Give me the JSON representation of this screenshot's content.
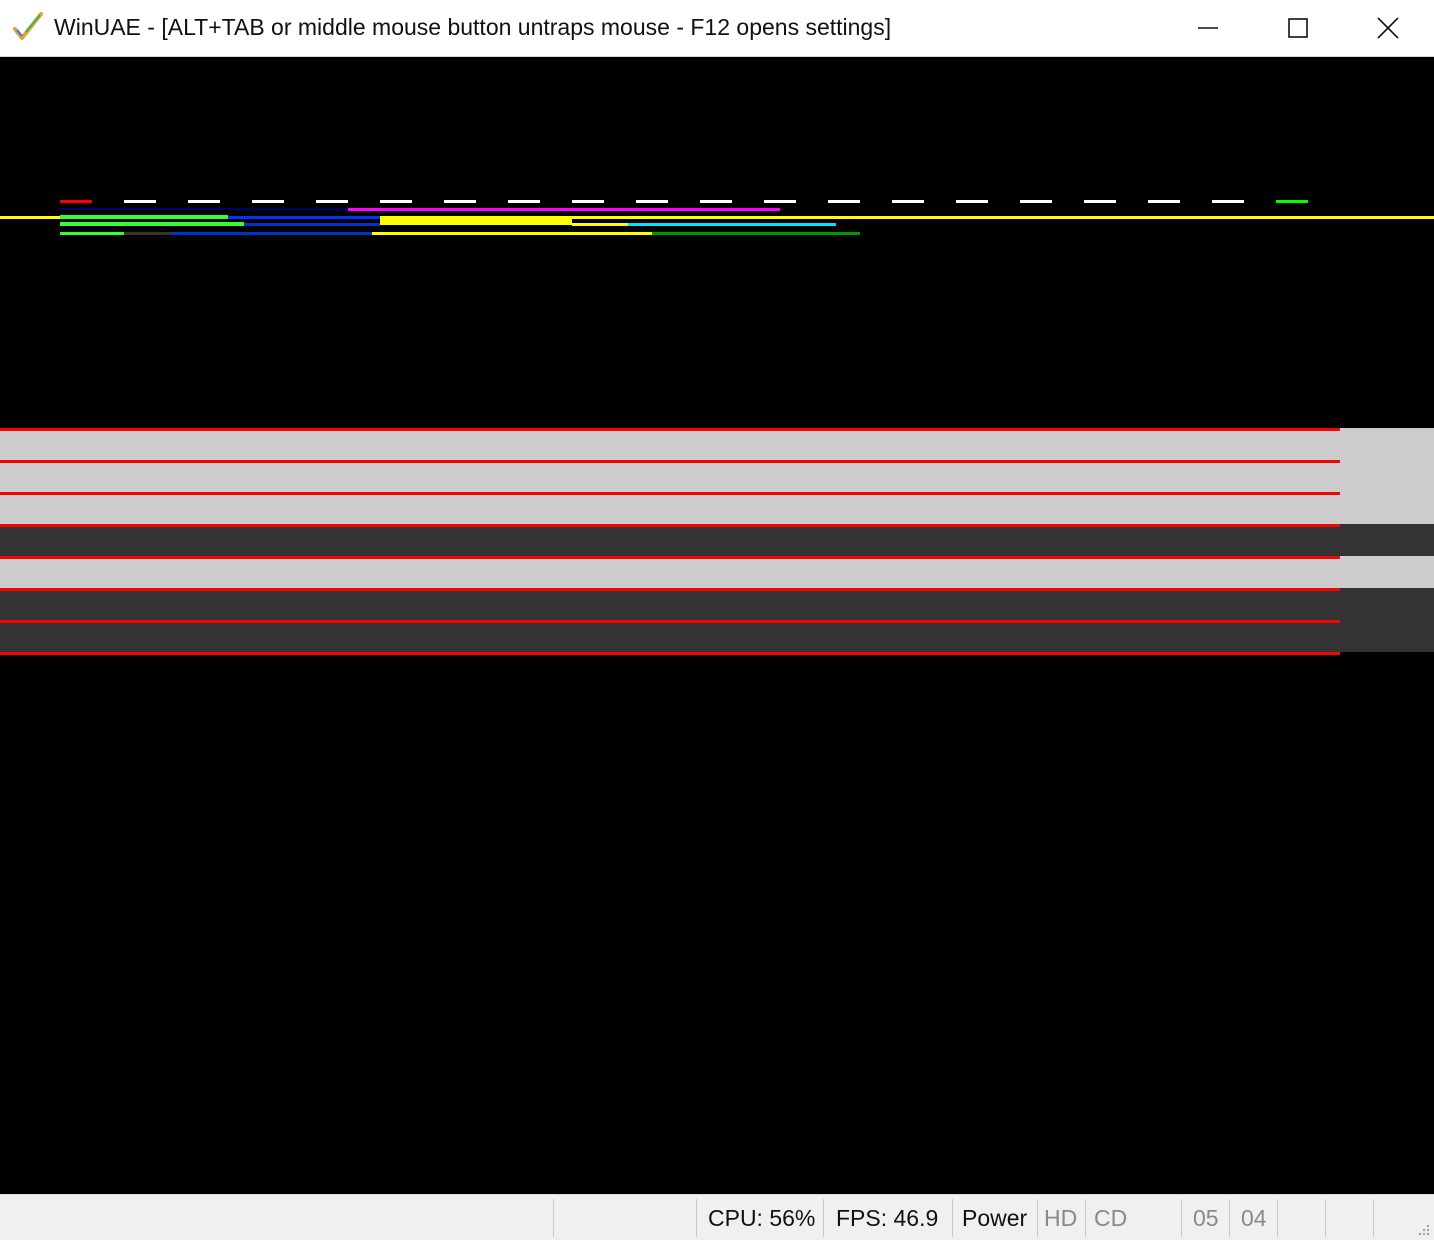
{
  "window": {
    "title": "WinUAE - [ALT+TAB or middle mouse button untraps mouse - F12 opens settings]",
    "controls": [
      "minimize-icon",
      "maximize-icon",
      "close-icon"
    ]
  },
  "status_bar": {
    "cpu": "CPU: 56%",
    "fps": "FPS: 46.9",
    "power": "Power",
    "hd": "HD",
    "cd": "CD",
    "drive_a": "05",
    "drive_b": "04"
  },
  "colors": {
    "band_light": "#cccccc",
    "band_dark": "#333333",
    "raster_line": "#ff0000",
    "debug_yellow": "#ffff00"
  }
}
